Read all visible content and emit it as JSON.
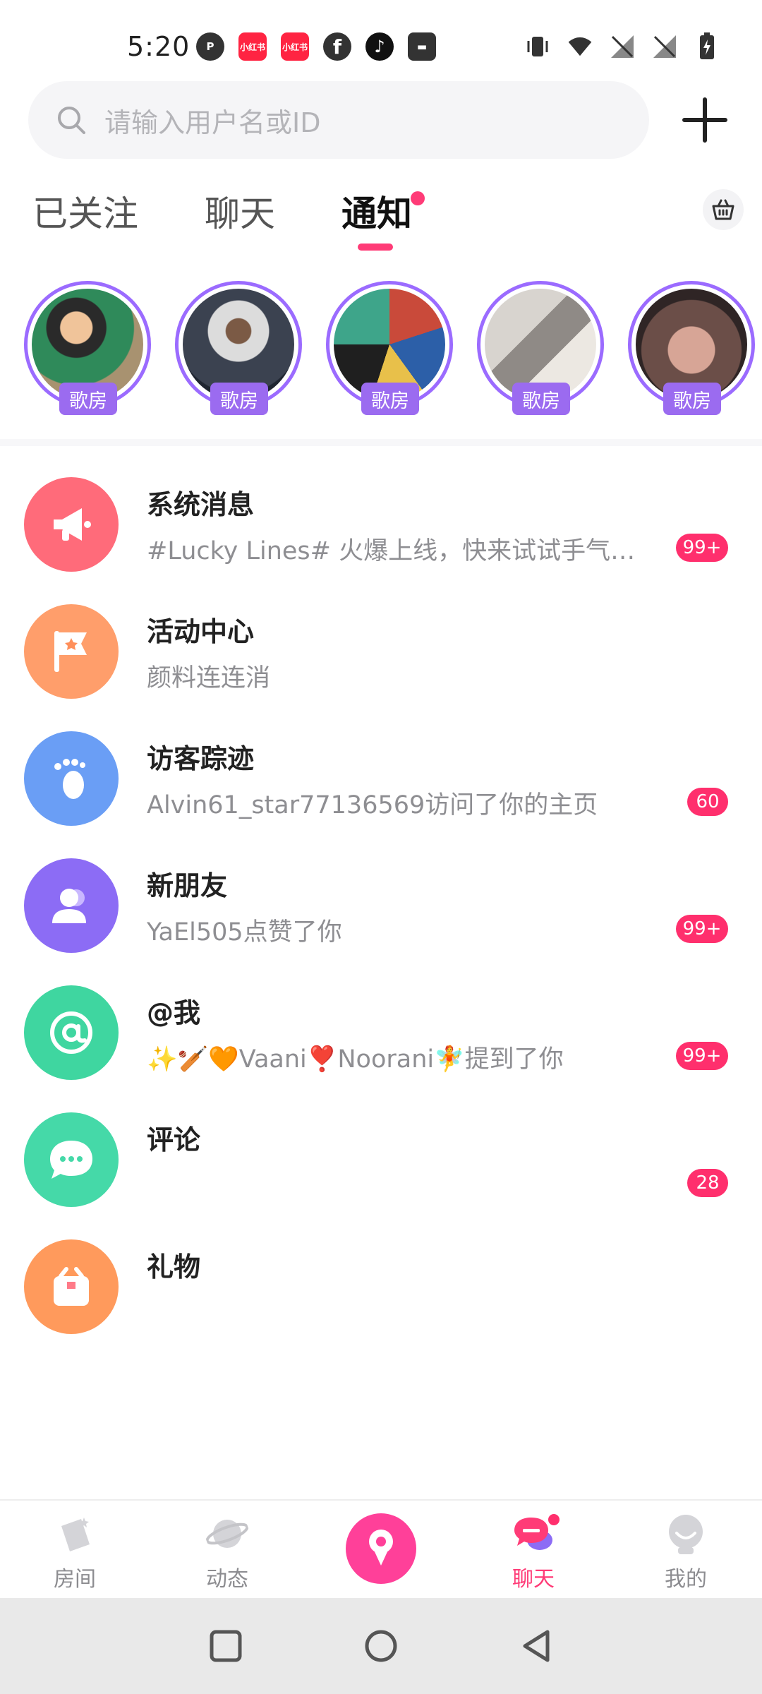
{
  "status_bar": {
    "time": "5:20",
    "app_icons": [
      "p-icon",
      "xiaohongshu-icon",
      "xiaohongshu-icon",
      "facebook-icon",
      "tiktok-icon",
      "inbox-icon"
    ],
    "xhs_label": "小红书"
  },
  "search": {
    "placeholder": "请输入用户名或ID"
  },
  "tabs": [
    {
      "label": "已关注"
    },
    {
      "label": "聊天"
    },
    {
      "label": "通知",
      "active": true,
      "has_dot": true
    }
  ],
  "rooms": [
    {
      "badge": "歌房",
      "color": "#3a6b4f"
    },
    {
      "badge": "歌房",
      "color": "#3b4250"
    },
    {
      "badge": "歌房",
      "color": "#c94a3a"
    },
    {
      "badge": "歌房",
      "color": "#b8b4b0"
    },
    {
      "badge": "歌房",
      "color": "#6b4e48"
    }
  ],
  "notifications": [
    {
      "title": "系统消息",
      "subtitle": "#Lucky Lines# 火爆上线，快来试试手气，…",
      "badge": "99+",
      "icon": "megaphone-icon",
      "color": "#ff6b7a"
    },
    {
      "title": "活动中心",
      "subtitle": "颜料连连消",
      "badge": "",
      "icon": "flag-icon",
      "color": "#ff9e6b"
    },
    {
      "title": "访客踪迹",
      "subtitle": "Alvin61_star77136569访问了你的主页",
      "badge": "60",
      "icon": "footprint-icon",
      "color": "#6a9ef5"
    },
    {
      "title": "新朋友",
      "subtitle": "YaEl505点赞了你",
      "badge": "99+",
      "icon": "person-icon",
      "color": "#8c6cf5"
    },
    {
      "title": "@我",
      "subtitle": "✨🏏🧡Vaani❣️Noorani🧚提到了你",
      "badge": "99+",
      "icon": "at-icon",
      "color": "#3fd6a0"
    },
    {
      "title": "评论",
      "subtitle": "",
      "badge": "28",
      "icon": "comment-icon",
      "color": "#45d9a8"
    },
    {
      "title": "礼物",
      "subtitle": "",
      "badge": "",
      "icon": "gift-icon",
      "color": "#ff9a5c"
    }
  ],
  "bottom_nav": [
    {
      "label": "房间",
      "icon": "room-icon"
    },
    {
      "label": "动态",
      "icon": "planet-icon"
    },
    {
      "label": "",
      "icon": "microphone-icon"
    },
    {
      "label": "聊天",
      "icon": "chat-icon",
      "active": true,
      "has_dot": true
    },
    {
      "label": "我的",
      "icon": "profile-icon"
    }
  ],
  "colors": {
    "accent": "#ff3b77",
    "room_ring": "#9b6bff"
  }
}
